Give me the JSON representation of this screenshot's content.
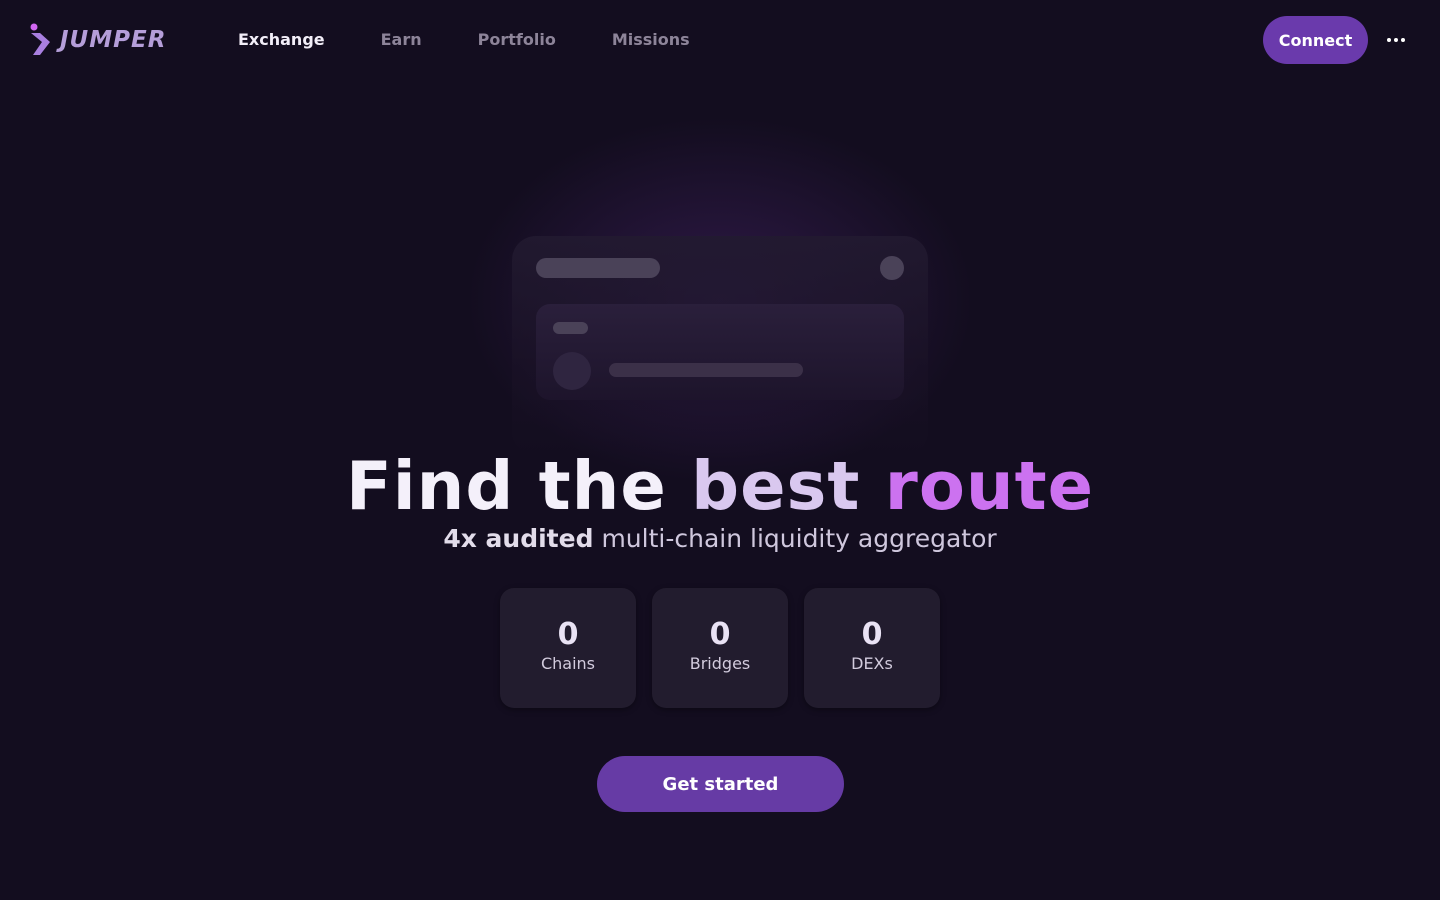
{
  "header": {
    "logo_text": "JUMPER",
    "nav": [
      {
        "label": "Exchange",
        "active": true
      },
      {
        "label": "Earn",
        "active": false
      },
      {
        "label": "Portfolio",
        "active": false
      },
      {
        "label": "Missions",
        "active": false
      }
    ],
    "connect_label": "Connect",
    "menu_icon": "more-horizontal-icon"
  },
  "hero": {
    "title_part1": "Find the",
    "title_part2": "best",
    "title_part3": "route",
    "subtitle_bold": "4x audited",
    "subtitle_rest": "multi-chain liquidity aggregator"
  },
  "stats": [
    {
      "value": "0",
      "label": "Chains"
    },
    {
      "value": "0",
      "label": "Bridges"
    },
    {
      "value": "0",
      "label": "DEXs"
    }
  ],
  "cta_label": "Get started",
  "colors": {
    "background": "#130d1f",
    "accent": "#6a3aac",
    "highlight": "#cc72f0"
  }
}
